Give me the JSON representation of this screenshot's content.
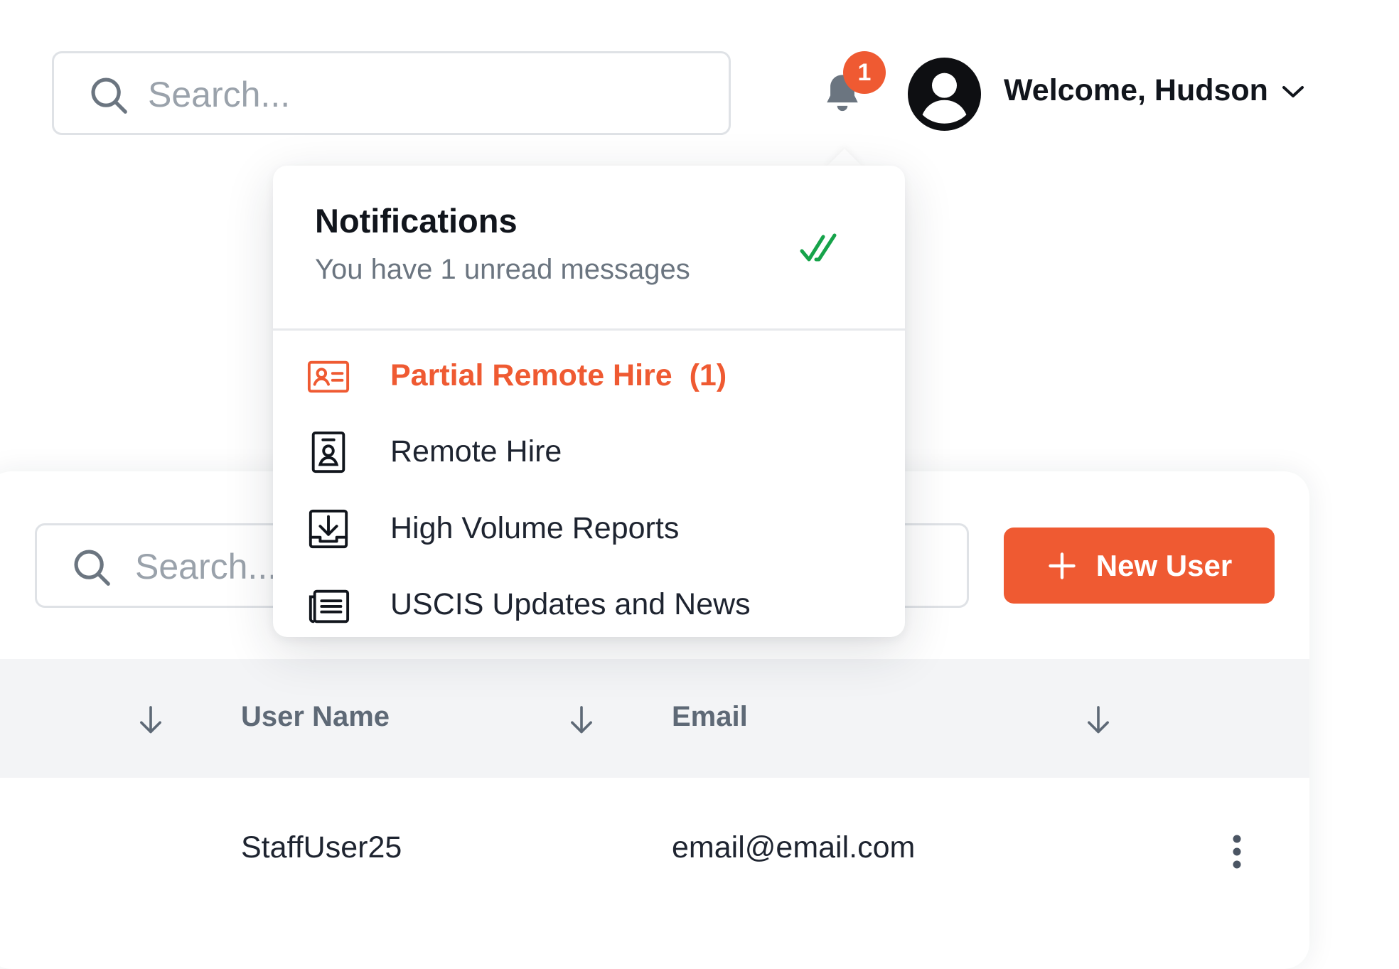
{
  "header": {
    "search": {
      "placeholder": "Search..."
    },
    "notifications_badge": "1",
    "welcome_text": "Welcome, Hudson"
  },
  "notifications": {
    "title": "Notifications",
    "subtitle": "You have 1 unread messages",
    "items": [
      {
        "label": "Partial Remote Hire",
        "count": "(1)",
        "icon": "id-card-icon",
        "active": true
      },
      {
        "label": "Remote Hire",
        "icon": "badge-icon",
        "active": false
      },
      {
        "label": "High Volume Reports",
        "icon": "download-tray-icon",
        "active": false
      },
      {
        "label": "USCIS Updates and News",
        "icon": "newspaper-icon",
        "active": false
      }
    ]
  },
  "table": {
    "search": {
      "placeholder": "Search..."
    },
    "new_user_label": "New User",
    "columns": [
      "User Name",
      "Email"
    ],
    "rows": [
      {
        "user_name": "StaffUser25",
        "email": "email@email.com"
      }
    ]
  },
  "colors": {
    "accent": "#ef5a32",
    "success": "#16a34a",
    "header_bg": "#f3f4f6"
  }
}
